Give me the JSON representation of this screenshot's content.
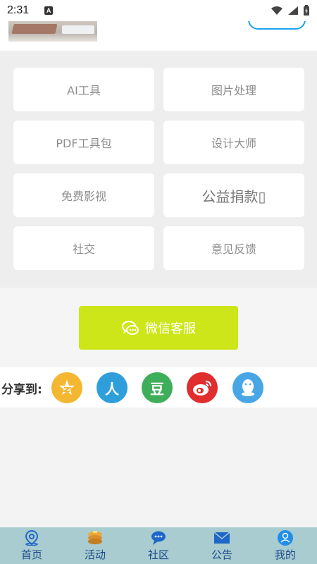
{
  "status_bar": {
    "time": "2:31",
    "indicator": "A"
  },
  "top": {
    "banner_image": "desk-photo"
  },
  "tools": [
    {
      "label": "AI工具"
    },
    {
      "label": "图片处理"
    },
    {
      "label": "PDF工具包"
    },
    {
      "label": "设计大师"
    },
    {
      "label": "免费影视"
    },
    {
      "label": "公益捐款▯"
    },
    {
      "label": "社交"
    },
    {
      "label": "意见反馈"
    }
  ],
  "service": {
    "label": "微信客服",
    "color": "#cde61a"
  },
  "share": {
    "label": "分享到:",
    "targets": [
      {
        "name": "qzone",
        "glyph": "★",
        "color": "#f4b731"
      },
      {
        "name": "renren",
        "glyph": "人",
        "color": "#2f9fdb"
      },
      {
        "name": "douban",
        "glyph": "豆",
        "color": "#3fae5a"
      },
      {
        "name": "weibo",
        "glyph": "",
        "color": "#e02d2d"
      },
      {
        "name": "qq",
        "glyph": "",
        "color": "#49a6e5"
      }
    ]
  },
  "nav": {
    "items": [
      {
        "label": "首页",
        "icon": "location-pin-icon"
      },
      {
        "label": "活动",
        "icon": "pancake-stack-icon"
      },
      {
        "label": "社区",
        "icon": "chat-bubble-icon"
      },
      {
        "label": "公告",
        "icon": "envelope-icon"
      },
      {
        "label": "我的",
        "icon": "person-icon"
      }
    ],
    "background": "#a8cccf"
  }
}
